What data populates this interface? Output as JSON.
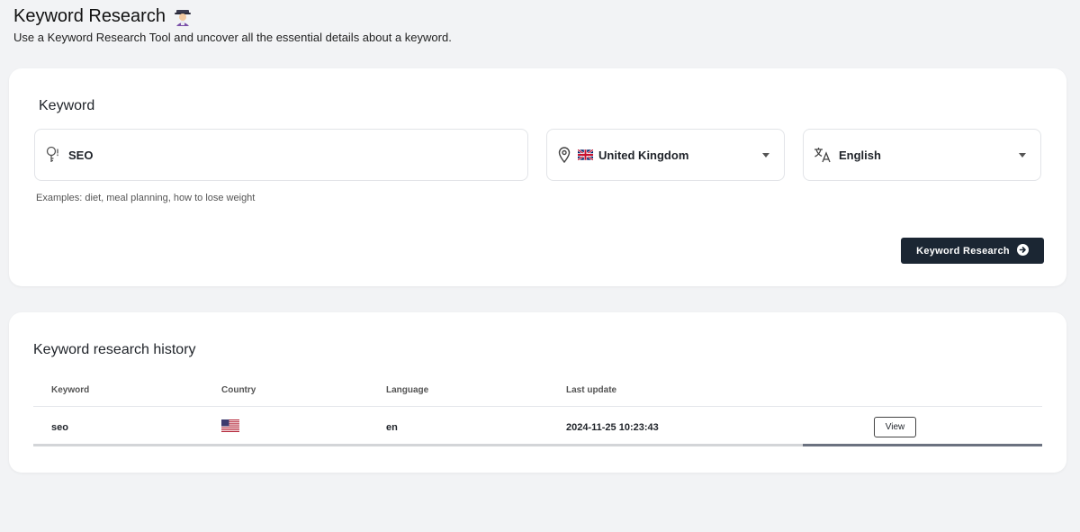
{
  "header": {
    "title": "Keyword Research",
    "subtitle": "Use a Keyword Research Tool and uncover all the essential details about a keyword."
  },
  "search_card": {
    "label": "Keyword",
    "keyword_value": "SEO",
    "country_value": "United Kingdom",
    "language_value": "English",
    "examples": "Examples: diet, meal planning, how to lose weight",
    "submit_label": "Keyword Research"
  },
  "history": {
    "title": "Keyword research history",
    "columns": [
      "Keyword",
      "Country",
      "Language",
      "Last update"
    ],
    "rows": [
      {
        "keyword": "seo",
        "country_flag": "us-flag-icon",
        "language": "en",
        "last_update": "2024-11-25 10:23:43",
        "action_label": "View"
      }
    ]
  },
  "colors": {
    "background": "#f2f3f5",
    "card": "#ffffff",
    "primary_button": "#1b2633"
  }
}
